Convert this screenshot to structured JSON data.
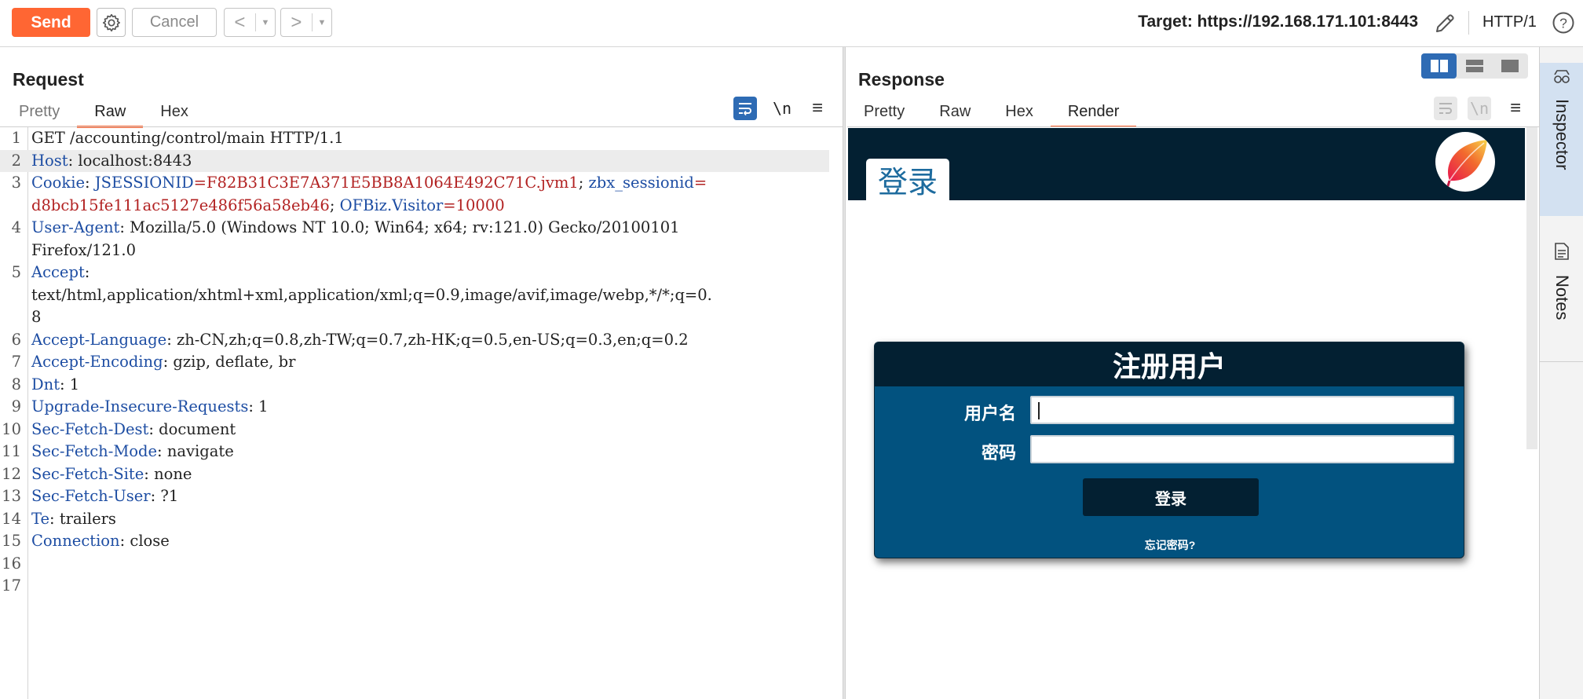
{
  "toolbar": {
    "send_label": "Send",
    "cancel_label": "Cancel",
    "back_arrow": "<",
    "forward_arrow": ">",
    "dropdown_glyph": "▼",
    "target_text": "Target: https://192.168.171.101:8443",
    "http_version": "HTTP/1",
    "help_glyph": "?"
  },
  "request": {
    "title": "Request",
    "tabs": [
      "Pretty",
      "Raw",
      "Hex"
    ],
    "active_tab": "Raw",
    "newline_toggle": "\\n",
    "menu_glyph": "≡",
    "lines": [
      {
        "num": "1",
        "parts": [
          {
            "t": "GET /accounting/control/main HTTP/1.1",
            "c": "v"
          }
        ]
      },
      {
        "num": "2",
        "highlight": true,
        "parts": [
          {
            "t": "Host",
            "c": "k"
          },
          {
            "t": ": localhost:8443",
            "c": "v"
          }
        ]
      },
      {
        "num": "3",
        "parts": [
          {
            "t": "Cookie",
            "c": "k"
          },
          {
            "t": ": ",
            "c": "v"
          },
          {
            "t": "JSESSIONID",
            "c": "k"
          },
          {
            "t": "=F82B31C3E7A371E5BB8A1064E492C71C.jvm1",
            "c": "cv"
          },
          {
            "t": "; ",
            "c": "v"
          },
          {
            "t": "zbx_sessionid",
            "c": "k"
          },
          {
            "t": "=",
            "c": "cv"
          }
        ]
      },
      {
        "num": "",
        "parts": [
          {
            "t": "d8bcb15fe111ac5127e486f56a58eb46",
            "c": "cv"
          },
          {
            "t": "; ",
            "c": "v"
          },
          {
            "t": "OFBiz.Visitor",
            "c": "k"
          },
          {
            "t": "=10000",
            "c": "cv"
          }
        ]
      },
      {
        "num": "4",
        "parts": [
          {
            "t": "User-Agent",
            "c": "k"
          },
          {
            "t": ": Mozilla/5.0 (Windows NT 10.0; Win64; x64; rv:121.0) Gecko/20100101",
            "c": "v"
          }
        ]
      },
      {
        "num": "",
        "parts": [
          {
            "t": "Firefox/121.0",
            "c": "v"
          }
        ]
      },
      {
        "num": "5",
        "parts": [
          {
            "t": "Accept",
            "c": "k"
          },
          {
            "t": ":",
            "c": "v"
          }
        ]
      },
      {
        "num": "",
        "parts": [
          {
            "t": "text/html,application/xhtml+xml,application/xml;q=0.9,image/avif,image/webp,*/*;q=0.",
            "c": "v"
          }
        ]
      },
      {
        "num": "",
        "parts": [
          {
            "t": "8",
            "c": "v"
          }
        ]
      },
      {
        "num": "6",
        "parts": [
          {
            "t": "Accept-Language",
            "c": "k"
          },
          {
            "t": ": zh-CN,zh;q=0.8,zh-TW;q=0.7,zh-HK;q=0.5,en-US;q=0.3,en;q=0.2",
            "c": "v"
          }
        ]
      },
      {
        "num": "7",
        "parts": [
          {
            "t": "Accept-Encoding",
            "c": "k"
          },
          {
            "t": ": gzip, deflate, br",
            "c": "v"
          }
        ]
      },
      {
        "num": "8",
        "parts": [
          {
            "t": "Dnt",
            "c": "k"
          },
          {
            "t": ": 1",
            "c": "v"
          }
        ]
      },
      {
        "num": "9",
        "parts": [
          {
            "t": "Upgrade-Insecure-Requests",
            "c": "k"
          },
          {
            "t": ": 1",
            "c": "v"
          }
        ]
      },
      {
        "num": "10",
        "parts": [
          {
            "t": "Sec-Fetch-Dest",
            "c": "k"
          },
          {
            "t": ": document",
            "c": "v"
          }
        ]
      },
      {
        "num": "11",
        "parts": [
          {
            "t": "Sec-Fetch-Mode",
            "c": "k"
          },
          {
            "t": ": navigate",
            "c": "v"
          }
        ]
      },
      {
        "num": "12",
        "parts": [
          {
            "t": "Sec-Fetch-Site",
            "c": "k"
          },
          {
            "t": ": none",
            "c": "v"
          }
        ]
      },
      {
        "num": "13",
        "parts": [
          {
            "t": "Sec-Fetch-User",
            "c": "k"
          },
          {
            "t": ": ?1",
            "c": "v"
          }
        ]
      },
      {
        "num": "14",
        "parts": [
          {
            "t": "Te",
            "c": "k"
          },
          {
            "t": ": trailers",
            "c": "v"
          }
        ]
      },
      {
        "num": "15",
        "parts": [
          {
            "t": "Connection",
            "c": "k"
          },
          {
            "t": ": close",
            "c": "v"
          }
        ]
      },
      {
        "num": "16",
        "parts": []
      },
      {
        "num": "17",
        "parts": []
      }
    ]
  },
  "response": {
    "title": "Response",
    "tabs": [
      "Pretty",
      "Raw",
      "Hex",
      "Render"
    ],
    "active_tab": "Render",
    "newline_toggle": "\\n",
    "menu_glyph": "≡",
    "render": {
      "login_tab": "登录",
      "dialog_title": "注册用户",
      "username_label": "用户名",
      "username_value": "",
      "password_label": "密码",
      "password_value": "",
      "login_button": "登录",
      "forgot_link": "忘记密码?"
    }
  },
  "sidebar": {
    "inspector_label": "Inspector",
    "notes_label": "Notes"
  },
  "colors": {
    "send": "#ff6633",
    "active_tab_underline": "#ff6633",
    "toggle_active": "#2e6bb4",
    "header_key": "#1d4da3",
    "cookie_value": "#b22222",
    "page_header": "#032032",
    "dialog_body": "#02527f"
  }
}
